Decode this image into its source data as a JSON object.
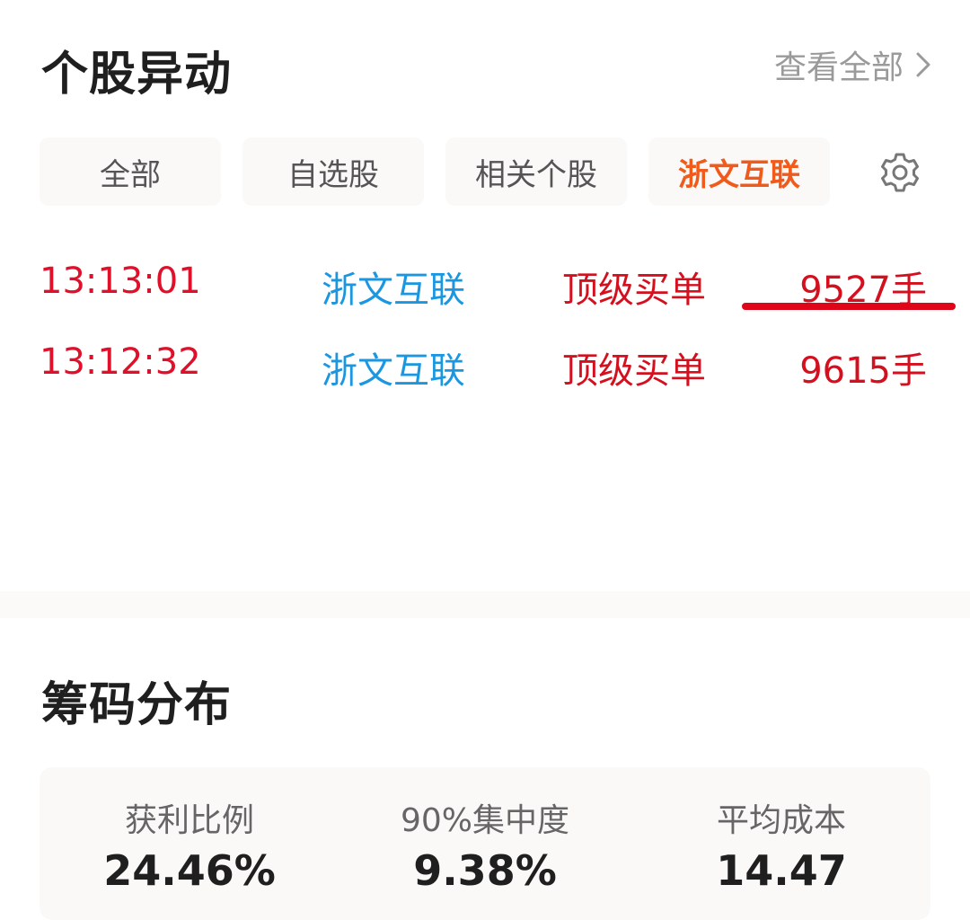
{
  "anomaly": {
    "title": "个股异动",
    "view_all": "查看全部",
    "tabs": [
      {
        "label": "全部",
        "active": false
      },
      {
        "label": "自选股",
        "active": false
      },
      {
        "label": "相关个股",
        "active": false
      },
      {
        "label": "浙文互联",
        "active": true
      }
    ],
    "rows": [
      {
        "time": "13:13:01",
        "stock": "浙文互联",
        "type": "顶级买单",
        "volume": "9527手"
      },
      {
        "time": "13:12:32",
        "stock": "浙文互联",
        "type": "顶级买单",
        "volume": "9615手"
      }
    ],
    "colors": {
      "time": "#e0102a",
      "stock": "#1a97e0",
      "type": "#d4101f",
      "active_tab": "#f05a1a"
    }
  },
  "chips": {
    "title": "筹码分布",
    "stats": [
      {
        "label": "获利比例",
        "value": "24.46%"
      },
      {
        "label": "90%集中度",
        "value": "9.38%"
      },
      {
        "label": "平均成本",
        "value": "14.47"
      }
    ]
  }
}
